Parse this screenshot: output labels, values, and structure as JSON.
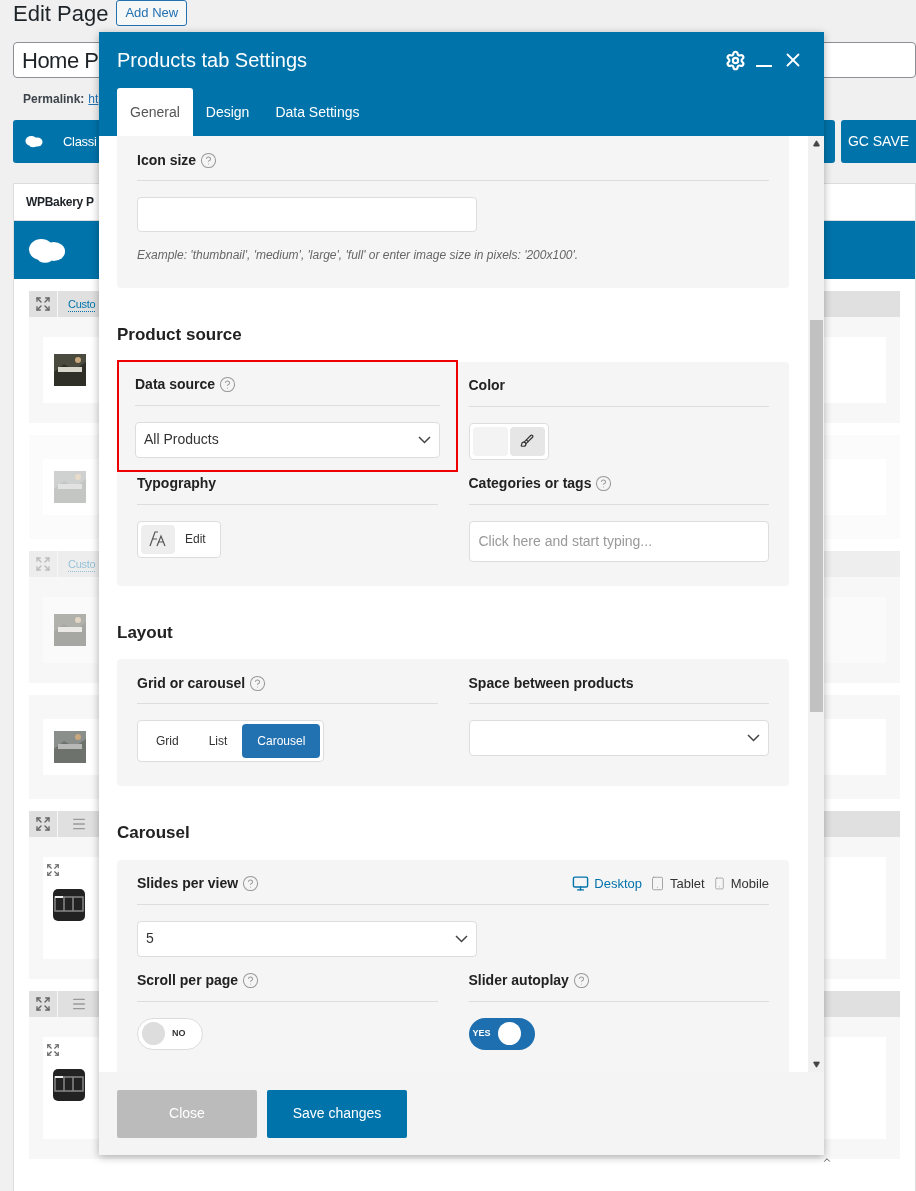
{
  "page": {
    "heading": "Edit Page",
    "add_new": "Add New",
    "post_title": "Home P",
    "permalink": {
      "label": "Permalink:",
      "link": "ht"
    },
    "editor_button": "Classi",
    "save_button": "GC SAVE",
    "builder": {
      "title": "WPBakery P",
      "blocks": [
        {
          "kind": "section",
          "link": "Custo",
          "faded": false
        },
        {
          "kind": "media",
          "faded": true
        },
        {
          "kind": "section",
          "link": "Custo",
          "faded": true
        },
        {
          "kind": "media",
          "faded": false
        },
        {
          "kind": "element"
        },
        {
          "kind": "element"
        }
      ]
    }
  },
  "modal": {
    "title": "Products tab Settings",
    "tabs": [
      {
        "label": "General",
        "selected": true
      },
      {
        "label": "Design",
        "selected": false
      },
      {
        "label": "Data Settings",
        "selected": false
      }
    ],
    "sections": [
      {
        "rows": [
          [
            {
              "kind": "text",
              "label": "Icon size",
              "help": true,
              "hint": "Example: 'thumbnail', 'medium', 'large', 'full' or enter image size in pixels: '200x100'."
            }
          ]
        ]
      },
      {
        "heading": "Product source",
        "rows": [
          [
            {
              "kind": "select",
              "label": "Data source",
              "help": true,
              "value": "All Products",
              "highlighted": true
            },
            {
              "kind": "color",
              "label": "Color",
              "help": false
            }
          ],
          [
            {
              "kind": "typography",
              "label": "Typography",
              "help": false,
              "button": "Edit"
            },
            {
              "kind": "tags",
              "label": "Categories or tags",
              "help": true,
              "placeholder": "Click here and start typing..."
            }
          ]
        ]
      },
      {
        "heading": "Layout",
        "rows": [
          [
            {
              "kind": "segmented",
              "label": "Grid or carousel",
              "help": true,
              "options": [
                {
                  "label": "Grid",
                  "selected": false
                },
                {
                  "label": "List",
                  "selected": false
                },
                {
                  "label": "Carousel",
                  "selected": true
                }
              ]
            },
            {
              "kind": "select",
              "label": "Space between products",
              "help": false
            }
          ]
        ]
      },
      {
        "heading": "Carousel",
        "rows": [
          [
            {
              "kind": "select",
              "label": "Slides per view",
              "help": true,
              "value": "5",
              "devices": [
                {
                  "kind": "desktop",
                  "label": "Desktop",
                  "selected": true
                },
                {
                  "kind": "tablet",
                  "label": "Tablet",
                  "selected": false
                },
                {
                  "kind": "mobile",
                  "label": "Mobile",
                  "selected": false
                }
              ]
            }
          ],
          [
            {
              "kind": "toggle",
              "label": "Scroll per page",
              "help": true,
              "on": false,
              "text": "NO"
            },
            {
              "kind": "toggle",
              "label": "Slider autoplay",
              "help": true,
              "on": true,
              "text": "YES"
            }
          ]
        ]
      }
    ],
    "buttons": [
      {
        "label": "Close",
        "disabled": true
      },
      {
        "label": "Save changes",
        "disabled": false
      }
    ]
  }
}
